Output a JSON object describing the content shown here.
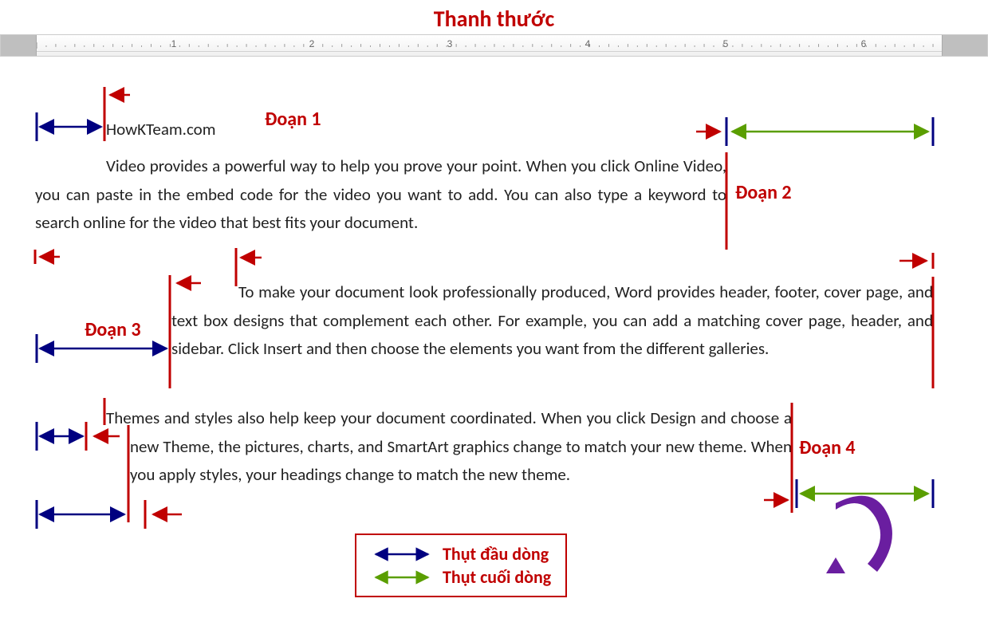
{
  "title": "Thanh thước",
  "ruler": {
    "numbers": [
      "1",
      "2",
      "3",
      "4",
      "5",
      "6"
    ]
  },
  "labels": {
    "p1": "Đoạn 1",
    "p2": "Đoạn 2",
    "p3": "Đoạn 3",
    "p4": "Đoạn 4"
  },
  "para1_firstline": "HowKTeam.com",
  "para2": "Video provides a powerful way to help you prove your point. When you click Online Video, you can paste in the embed code for the video you want to add. You can also type a keyword to search online for the video that best fits your document.",
  "para3": "To make your document look professionally produced, Word provides header, footer, cover page, and text box designs that complement each other. For example, you can add a matching cover page, header, and sidebar. Click Insert and then choose the elements you want from the different galleries.",
  "para4": "Themes and styles also help keep your document coordinated. When you click Design and choose a new Theme, the pictures, charts, and SmartArt graphics change to match your new theme. When you apply styles, your headings change to match the new theme.",
  "legend": {
    "indent_start": "Thụt đầu dòng",
    "indent_end": "Thụt cuối dòng"
  }
}
